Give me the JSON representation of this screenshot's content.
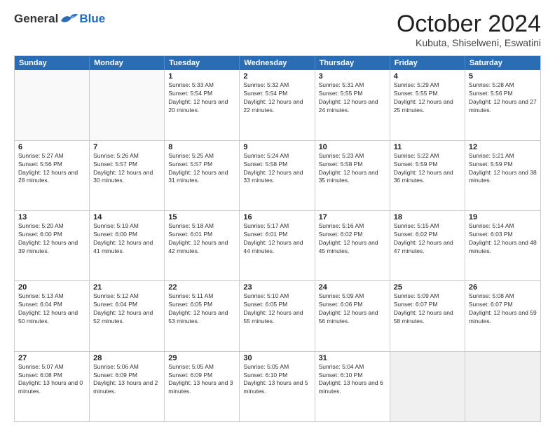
{
  "header": {
    "logo": {
      "general": "General",
      "blue": "Blue"
    },
    "title": "October 2024",
    "location": "Kubuta, Shiselweni, Eswatini"
  },
  "calendar": {
    "days_of_week": [
      "Sunday",
      "Monday",
      "Tuesday",
      "Wednesday",
      "Thursday",
      "Friday",
      "Saturday"
    ],
    "weeks": [
      [
        {
          "day": "",
          "empty": true
        },
        {
          "day": "",
          "empty": true
        },
        {
          "day": "1",
          "sunrise": "Sunrise: 5:33 AM",
          "sunset": "Sunset: 5:54 PM",
          "daylight": "Daylight: 12 hours and 20 minutes."
        },
        {
          "day": "2",
          "sunrise": "Sunrise: 5:32 AM",
          "sunset": "Sunset: 5:54 PM",
          "daylight": "Daylight: 12 hours and 22 minutes."
        },
        {
          "day": "3",
          "sunrise": "Sunrise: 5:31 AM",
          "sunset": "Sunset: 5:55 PM",
          "daylight": "Daylight: 12 hours and 24 minutes."
        },
        {
          "day": "4",
          "sunrise": "Sunrise: 5:29 AM",
          "sunset": "Sunset: 5:55 PM",
          "daylight": "Daylight: 12 hours and 25 minutes."
        },
        {
          "day": "5",
          "sunrise": "Sunrise: 5:28 AM",
          "sunset": "Sunset: 5:56 PM",
          "daylight": "Daylight: 12 hours and 27 minutes."
        }
      ],
      [
        {
          "day": "6",
          "sunrise": "Sunrise: 5:27 AM",
          "sunset": "Sunset: 5:56 PM",
          "daylight": "Daylight: 12 hours and 28 minutes."
        },
        {
          "day": "7",
          "sunrise": "Sunrise: 5:26 AM",
          "sunset": "Sunset: 5:57 PM",
          "daylight": "Daylight: 12 hours and 30 minutes."
        },
        {
          "day": "8",
          "sunrise": "Sunrise: 5:25 AM",
          "sunset": "Sunset: 5:57 PM",
          "daylight": "Daylight: 12 hours and 31 minutes."
        },
        {
          "day": "9",
          "sunrise": "Sunrise: 5:24 AM",
          "sunset": "Sunset: 5:58 PM",
          "daylight": "Daylight: 12 hours and 33 minutes."
        },
        {
          "day": "10",
          "sunrise": "Sunrise: 5:23 AM",
          "sunset": "Sunset: 5:58 PM",
          "daylight": "Daylight: 12 hours and 35 minutes."
        },
        {
          "day": "11",
          "sunrise": "Sunrise: 5:22 AM",
          "sunset": "Sunset: 5:59 PM",
          "daylight": "Daylight: 12 hours and 36 minutes."
        },
        {
          "day": "12",
          "sunrise": "Sunrise: 5:21 AM",
          "sunset": "Sunset: 5:59 PM",
          "daylight": "Daylight: 12 hours and 38 minutes."
        }
      ],
      [
        {
          "day": "13",
          "sunrise": "Sunrise: 5:20 AM",
          "sunset": "Sunset: 6:00 PM",
          "daylight": "Daylight: 12 hours and 39 minutes."
        },
        {
          "day": "14",
          "sunrise": "Sunrise: 5:19 AM",
          "sunset": "Sunset: 6:00 PM",
          "daylight": "Daylight: 12 hours and 41 minutes."
        },
        {
          "day": "15",
          "sunrise": "Sunrise: 5:18 AM",
          "sunset": "Sunset: 6:01 PM",
          "daylight": "Daylight: 12 hours and 42 minutes."
        },
        {
          "day": "16",
          "sunrise": "Sunrise: 5:17 AM",
          "sunset": "Sunset: 6:01 PM",
          "daylight": "Daylight: 12 hours and 44 minutes."
        },
        {
          "day": "17",
          "sunrise": "Sunrise: 5:16 AM",
          "sunset": "Sunset: 6:02 PM",
          "daylight": "Daylight: 12 hours and 45 minutes."
        },
        {
          "day": "18",
          "sunrise": "Sunrise: 5:15 AM",
          "sunset": "Sunset: 6:02 PM",
          "daylight": "Daylight: 12 hours and 47 minutes."
        },
        {
          "day": "19",
          "sunrise": "Sunrise: 5:14 AM",
          "sunset": "Sunset: 6:03 PM",
          "daylight": "Daylight: 12 hours and 48 minutes."
        }
      ],
      [
        {
          "day": "20",
          "sunrise": "Sunrise: 5:13 AM",
          "sunset": "Sunset: 6:04 PM",
          "daylight": "Daylight: 12 hours and 50 minutes."
        },
        {
          "day": "21",
          "sunrise": "Sunrise: 5:12 AM",
          "sunset": "Sunset: 6:04 PM",
          "daylight": "Daylight: 12 hours and 52 minutes."
        },
        {
          "day": "22",
          "sunrise": "Sunrise: 5:11 AM",
          "sunset": "Sunset: 6:05 PM",
          "daylight": "Daylight: 12 hours and 53 minutes."
        },
        {
          "day": "23",
          "sunrise": "Sunrise: 5:10 AM",
          "sunset": "Sunset: 6:05 PM",
          "daylight": "Daylight: 12 hours and 55 minutes."
        },
        {
          "day": "24",
          "sunrise": "Sunrise: 5:09 AM",
          "sunset": "Sunset: 6:06 PM",
          "daylight": "Daylight: 12 hours and 56 minutes."
        },
        {
          "day": "25",
          "sunrise": "Sunrise: 5:09 AM",
          "sunset": "Sunset: 6:07 PM",
          "daylight": "Daylight: 12 hours and 58 minutes."
        },
        {
          "day": "26",
          "sunrise": "Sunrise: 5:08 AM",
          "sunset": "Sunset: 6:07 PM",
          "daylight": "Daylight: 12 hours and 59 minutes."
        }
      ],
      [
        {
          "day": "27",
          "sunrise": "Sunrise: 5:07 AM",
          "sunset": "Sunset: 6:08 PM",
          "daylight": "Daylight: 13 hours and 0 minutes."
        },
        {
          "day": "28",
          "sunrise": "Sunrise: 5:06 AM",
          "sunset": "Sunset: 6:09 PM",
          "daylight": "Daylight: 13 hours and 2 minutes."
        },
        {
          "day": "29",
          "sunrise": "Sunrise: 5:05 AM",
          "sunset": "Sunset: 6:09 PM",
          "daylight": "Daylight: 13 hours and 3 minutes."
        },
        {
          "day": "30",
          "sunrise": "Sunrise: 5:05 AM",
          "sunset": "Sunset: 6:10 PM",
          "daylight": "Daylight: 13 hours and 5 minutes."
        },
        {
          "day": "31",
          "sunrise": "Sunrise: 5:04 AM",
          "sunset": "Sunset: 6:10 PM",
          "daylight": "Daylight: 13 hours and 6 minutes."
        },
        {
          "day": "",
          "empty": true
        },
        {
          "day": "",
          "empty": true
        }
      ]
    ]
  }
}
